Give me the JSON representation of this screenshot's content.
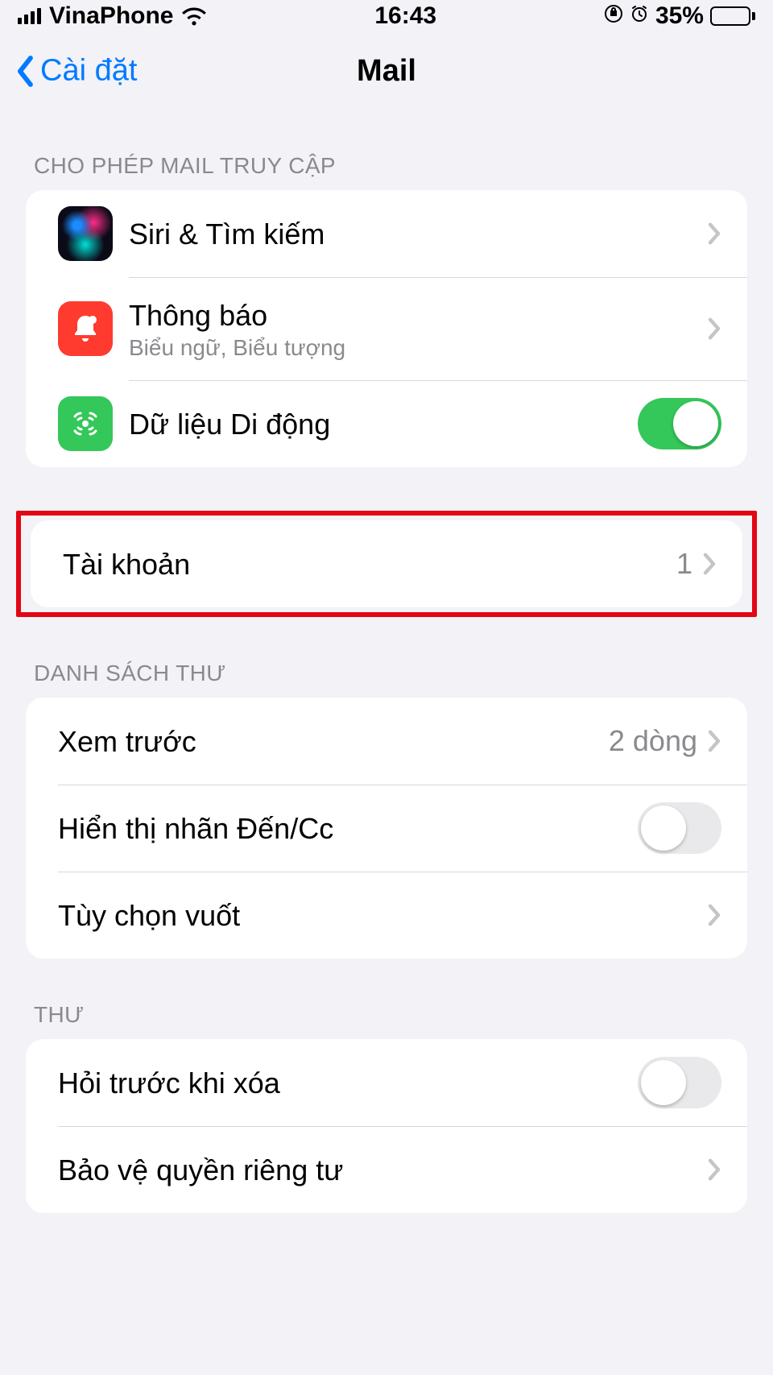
{
  "status": {
    "carrier": "VinaPhone",
    "time": "16:43",
    "battery_percent": "35%"
  },
  "nav": {
    "back_label": "Cài đặt",
    "title": "Mail"
  },
  "sections": {
    "access": {
      "header": "CHO PHÉP MAIL TRUY CẬP",
      "siri": {
        "label": "Siri & Tìm kiếm"
      },
      "notifications": {
        "label": "Thông báo",
        "sub": "Biểu ngữ, Biểu tượng"
      },
      "cellular": {
        "label": "Dữ liệu Di động",
        "on": true
      }
    },
    "accounts": {
      "label": "Tài khoản",
      "value": "1"
    },
    "mail_list": {
      "header": "DANH SÁCH THƯ",
      "preview": {
        "label": "Xem trước",
        "value": "2 dòng"
      },
      "tocc": {
        "label": "Hiển thị nhãn Đến/Cc",
        "on": false
      },
      "swipe": {
        "label": "Tùy chọn vuốt"
      }
    },
    "mail": {
      "header": "THƯ",
      "ask_delete": {
        "label": "Hỏi trước khi xóa",
        "on": false
      },
      "privacy": {
        "label": "Bảo vệ quyền riêng tư"
      }
    }
  }
}
